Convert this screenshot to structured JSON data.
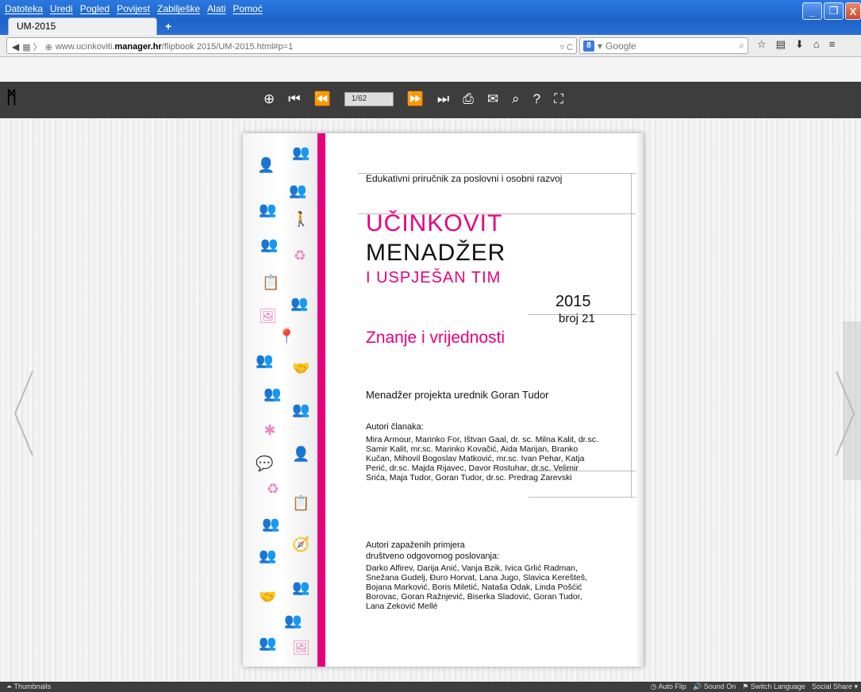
{
  "menu": [
    "Datoteka",
    "Uredi",
    "Pogled",
    "Povijest",
    "Zabilješke",
    "Alati",
    "Pomoć"
  ],
  "tab": {
    "title": "UM-2015",
    "new_tab": "+"
  },
  "window_controls": {
    "min": "_",
    "max": "❐",
    "close": "X"
  },
  "address": {
    "prefix": "www.ucinkoviti.",
    "domain": "manager.hr",
    "path": "/flipbook 2015/UM-2015.html#p=1",
    "controls": "▿ C"
  },
  "search": {
    "placeholder": "Google",
    "engine": "8"
  },
  "flipbook": {
    "page_indicator": "1/62"
  },
  "page": {
    "edu": "Edukativni priručnik za poslovni i osobni razvoj",
    "title1": "UČINKOVIT",
    "title2": "MENADŽER",
    "title3": "I USPJEŠAN TIM",
    "year": "2015",
    "issue": "broj 21",
    "subtitle": "Znanje i vrijednosti",
    "manager": "Menadžer projekta  urednik  Goran Tudor",
    "authors_heading": "Autori članaka:",
    "authors": "Mira Armour, Marinko For, Ištvan Gaal, dr. sc. Milna Kalit, dr.sc. Samir Kalit, mr.sc. Marinko Kovačić, Aida Marijan, Branko Kučan, Mihovil Bogoslav Matković, mr.sc. Ivan Pehar, Katja Perić, dr.sc. Majda Rijavec, Davor Rostuhar, dr.sc. Velimir Srića, Maja Tudor, Goran Tudor, dr.sc. Predrag Zarevski",
    "examples_heading1": "Autori zapaženih primjera",
    "examples_heading2": "društveno odgovornog poslovanja:",
    "examples": "Darko Alfirev, Darija Anić, Vanja Bzik, Ivica Grlić Radman, Snežana Gudelj, Đuro Horvat, Lana Jugo, Slavica Kerešteš, Bojana Marković, Boris Miletić, Nataša Odak, Linda Pošćić Borovac, Goran Ražnjević, Biserka Sladović, Goran Tudor, Lana Zeković Mellé"
  },
  "bottom": {
    "thumbnails": "Thumbnails",
    "auto_flip": "Auto Flip",
    "sound": "Sound On",
    "switch_language": "Switch Language",
    "social_share": "Social Share"
  }
}
